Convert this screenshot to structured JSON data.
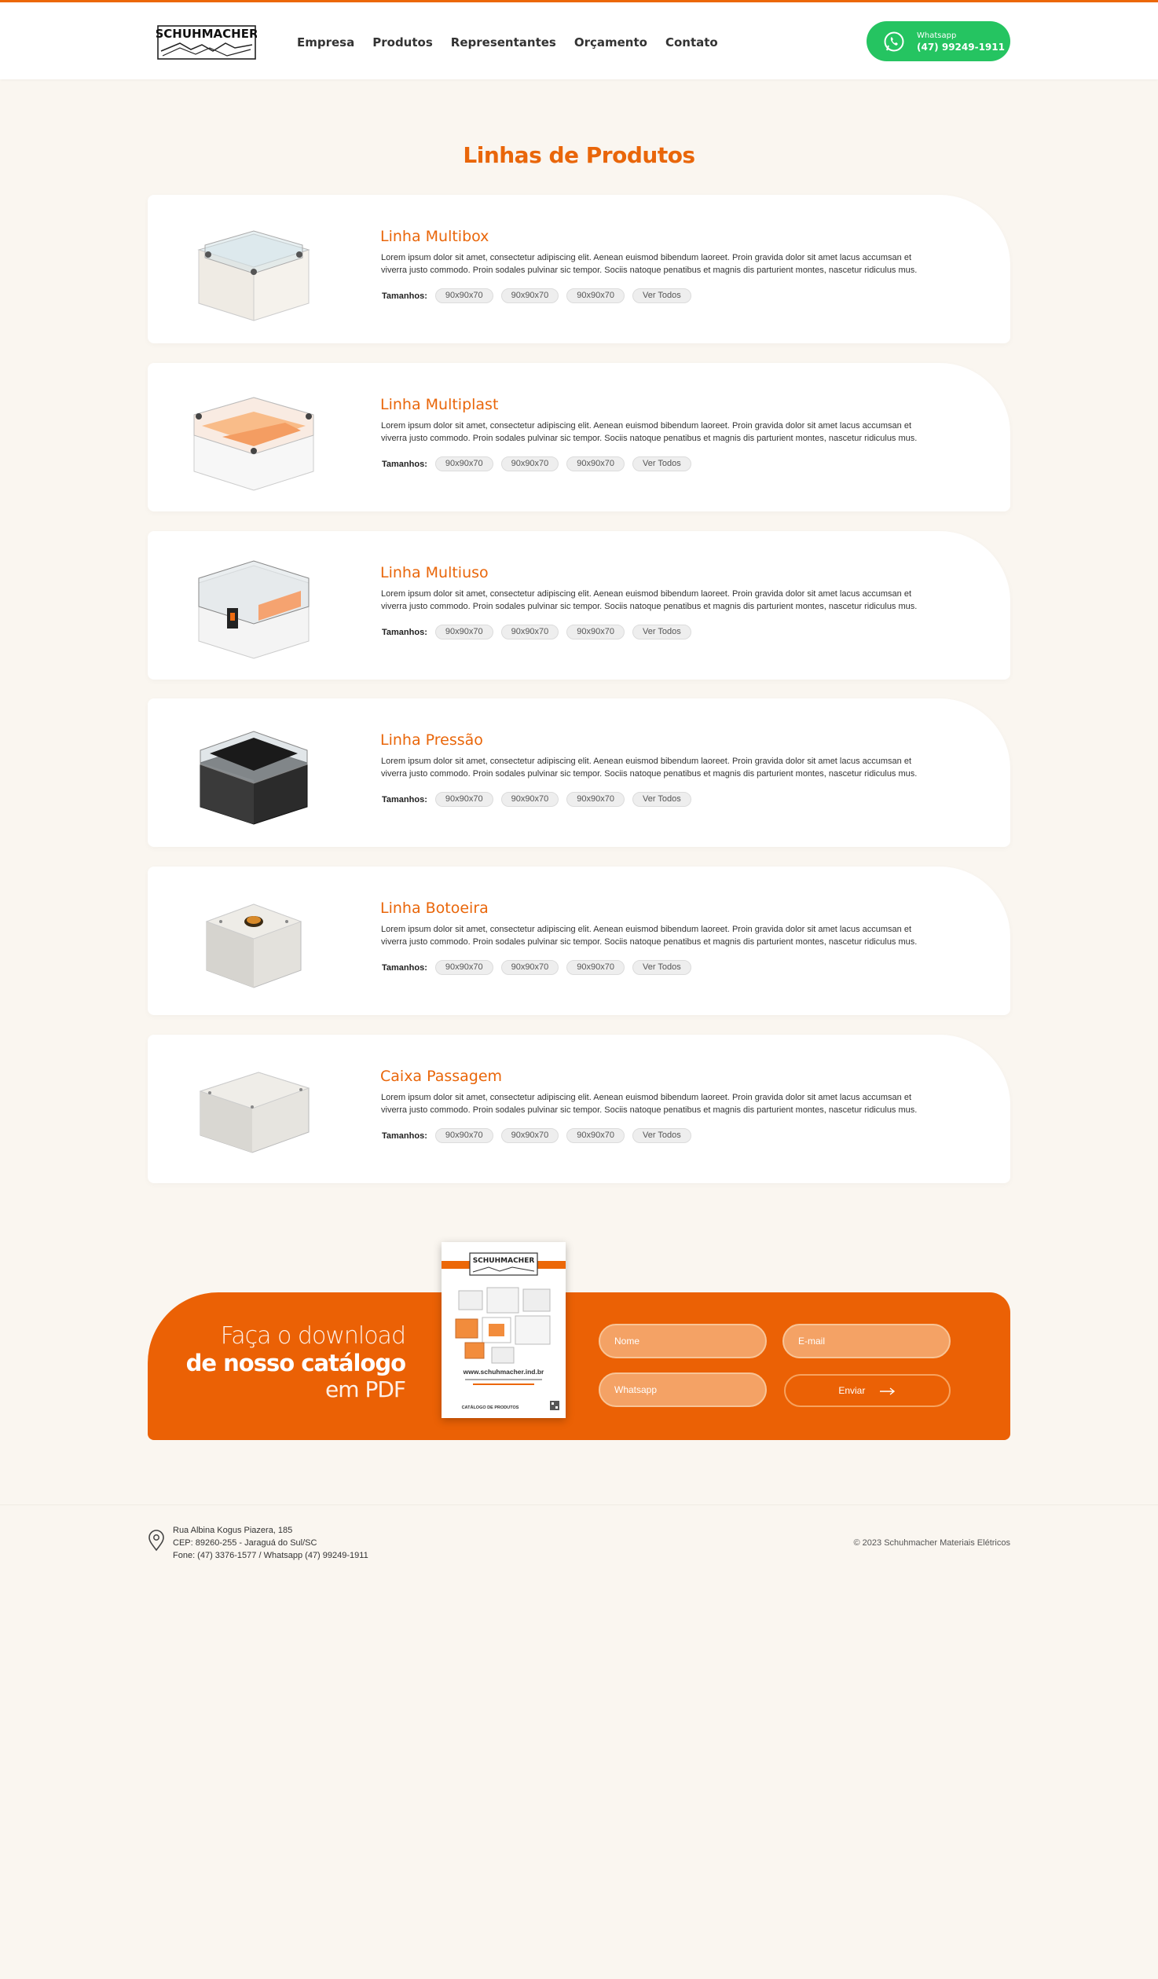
{
  "header": {
    "logo_text": "SCHUHMACHER",
    "nav": [
      "Empresa",
      "Produtos",
      "Representantes",
      "Orçamento",
      "Contato"
    ],
    "whatsapp": {
      "label": "Whatsapp",
      "number": "(47) 99249-1911",
      "color": "#25c461"
    }
  },
  "main": {
    "title": "Linhas de Produtos",
    "sizes_label": "Tamanhos:",
    "tags": [
      "90x90x70",
      "90x90x70",
      "90x90x70",
      "Ver Todos"
    ],
    "description": "Lorem ipsum dolor sit amet, consectetur adipiscing elit. Aenean euismod bibendum laoreet. Proin gravida dolor sit amet lacus accumsan et viverra justo commodo. Proin sodales pulvinar sic tempor. Sociis natoque penatibus et magnis dis parturient montes, nascetur ridiculus mus.",
    "products": [
      {
        "title": "Linha Multibox",
        "icon": "clear-lid-box-icon"
      },
      {
        "title": "Linha Multiplast",
        "icon": "orange-insert-box-icon"
      },
      {
        "title": "Linha Multiuso",
        "icon": "latched-clear-box-icon"
      },
      {
        "title": "Linha Pressão",
        "icon": "black-box-icon"
      },
      {
        "title": "Linha Botoeira",
        "icon": "button-box-icon"
      },
      {
        "title": "Caixa Passagem",
        "icon": "junction-box-icon"
      }
    ]
  },
  "catalog": {
    "line1": "Faça o download",
    "line2": "de nosso catálogo",
    "line3": "em PDF",
    "cover_brand": "SCHUHMACHER",
    "cover_site": "www.schuhmacher.ind.br",
    "cover_footer": "CATÁLOGO DE PRODUTOS",
    "form": {
      "name_placeholder": "Nome",
      "email_placeholder": "E-mail",
      "whatsapp_placeholder": "Whatsapp",
      "submit_label": "Enviar"
    },
    "color": "#eb6105"
  },
  "footer": {
    "address": [
      "Rua Albina Kogus Piazera, 185",
      "CEP: 89260-255 - Jaraguá do Sul/SC",
      "Fone: (47) 3376-1577 / Whatsapp (47) 99249-1911"
    ],
    "copyright": "© 2023 Schuhmacher Materiais Elétricos"
  }
}
